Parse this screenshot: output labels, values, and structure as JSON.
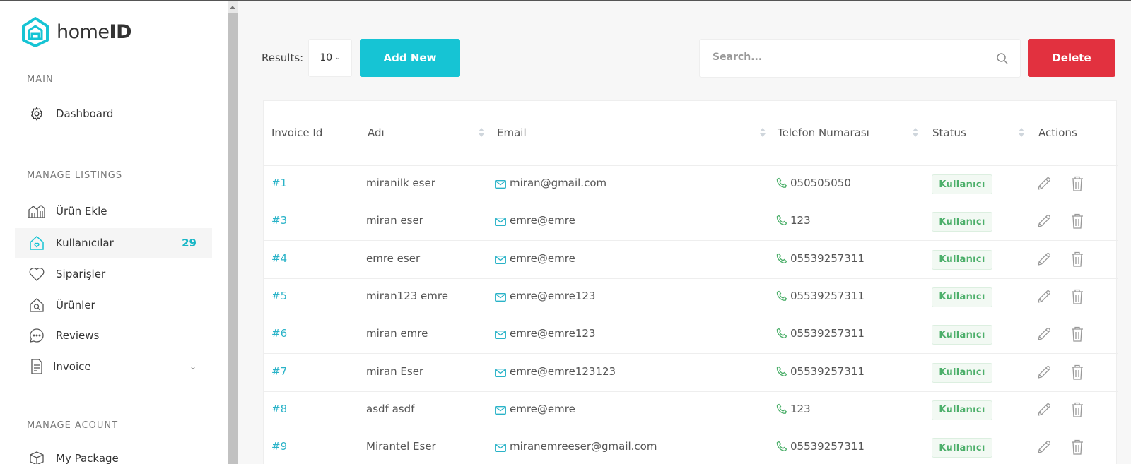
{
  "brand": {
    "name_light": "home",
    "name_bold": "ID",
    "accent": "#16c4d4"
  },
  "sidebar": {
    "sections": [
      {
        "title": "MAIN"
      },
      {
        "title": "MANAGE LISTINGS"
      },
      {
        "title": "MANAGE ACOUNT"
      }
    ],
    "items": [
      {
        "label": "Dashboard",
        "icon": "gear-icon"
      },
      {
        "label": "Ürün Ekle",
        "icon": "buildings-icon"
      },
      {
        "label": "Kullanıcılar",
        "icon": "house-heart-icon",
        "badge": "29",
        "active": true
      },
      {
        "label": "Siparişler",
        "icon": "heart-icon"
      },
      {
        "label": "Ürünler",
        "icon": "house-search-icon"
      },
      {
        "label": "Reviews",
        "icon": "chat-bubble-icon"
      },
      {
        "label": "Invoice",
        "icon": "document-icon"
      },
      {
        "label": "My Package",
        "icon": "package-icon"
      }
    ]
  },
  "toolbar": {
    "results_label": "Results:",
    "results_value": "10",
    "add_label": "Add New",
    "search_placeholder": "Search...",
    "delete_label": "Delete",
    "delete_color": "#e2313f"
  },
  "table": {
    "headers": [
      "Invoice Id",
      "Adı",
      "Email",
      "Telefon Numarası",
      "Status",
      "Actions"
    ],
    "rows": [
      {
        "id": "#1",
        "name": "miranilk eser",
        "email": "miran@gmail.com",
        "phone": "050505050",
        "status": "Kullanıcı"
      },
      {
        "id": "#3",
        "name": "miran eser",
        "email": "emre@emre",
        "phone": "123",
        "status": "Kullanıcı"
      },
      {
        "id": "#4",
        "name": "emre eser",
        "email": "emre@emre",
        "phone": "05539257311",
        "status": "Kullanıcı"
      },
      {
        "id": "#5",
        "name": "miran123 emre",
        "email": "emre@emre123",
        "phone": "05539257311",
        "status": "Kullanıcı"
      },
      {
        "id": "#6",
        "name": "miran emre",
        "email": "emre@emre123",
        "phone": "05539257311",
        "status": "Kullanıcı"
      },
      {
        "id": "#7",
        "name": "miran Eser",
        "email": "emre@emre123123",
        "phone": "05539257311",
        "status": "Kullanıcı"
      },
      {
        "id": "#8",
        "name": "asdf asdf",
        "email": "emre@emre",
        "phone": "123",
        "status": "Kullanıcı"
      },
      {
        "id": "#9",
        "name": "Mirantel Eser",
        "email": "miranemreeser@gmail.com",
        "phone": "05539257311",
        "status": "Kullanıcı"
      }
    ]
  }
}
